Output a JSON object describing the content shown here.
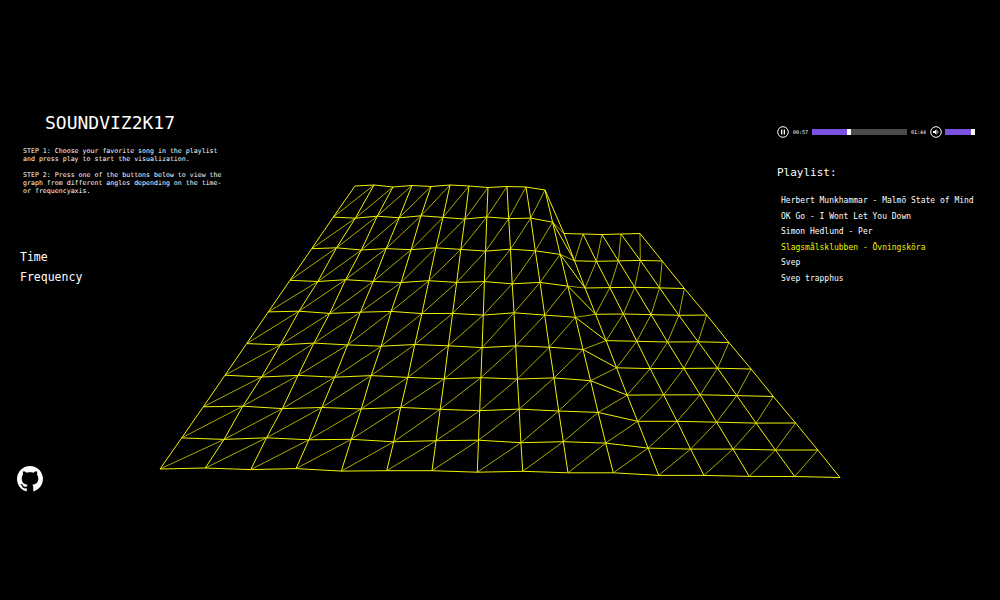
{
  "app": {
    "title": "SOUNDVIZ2K17",
    "steps": [
      "STEP 1: Choose your favorite song in the playlist and press play to start the visualization.",
      "STEP 2: Press one of the buttons below to view the graph from different angles depending on the time- or frequencyaxis."
    ]
  },
  "view_buttons": [
    {
      "label": "Time"
    },
    {
      "label": "Frequency"
    }
  ],
  "player": {
    "playing": true,
    "elapsed": "00:57",
    "duration": "01:44",
    "progress": {
      "level": 0.37
    },
    "volume": {
      "level": 0.88
    }
  },
  "playlist": {
    "heading": "Playlist:",
    "items": [
      {
        "title": "Herbert Munkhammar - Malmö State of Mind",
        "selected": false
      },
      {
        "title": "OK Go - I Wont Let You Down",
        "selected": false
      },
      {
        "title": "Simon Hedlund - Per",
        "selected": false
      },
      {
        "title": "Slagsmålsklubben - Övningsköra",
        "selected": true
      },
      {
        "title": "Svep",
        "selected": false
      },
      {
        "title": "Svep trapphus",
        "selected": false
      }
    ]
  },
  "chart": {
    "surface": [
      [
        0.02,
        0.05,
        0.03,
        0.06,
        0.02,
        0.04,
        0.05,
        0.03,
        0.06,
        0.04,
        0.05,
        0.01,
        0.02,
        0.01,
        0.02,
        0.01
      ],
      [
        0.12,
        0.1,
        0.14,
        0.11,
        0.13,
        0.09,
        0.12,
        0.14,
        0.1,
        0.13,
        0.11,
        0.02,
        0.01,
        0.02,
        0.01,
        0.02
      ],
      [
        0.22,
        0.24,
        0.2,
        0.23,
        0.21,
        0.25,
        0.22,
        0.2,
        0.24,
        0.21,
        0.19,
        0.02,
        0.03,
        0.02,
        0.01,
        0.02
      ],
      [
        0.33,
        0.3,
        0.34,
        0.31,
        0.35,
        0.32,
        0.3,
        0.33,
        0.31,
        0.34,
        0.29,
        0.01,
        0.02,
        0.03,
        0.02,
        0.01
      ],
      [
        0.44,
        0.42,
        0.46,
        0.43,
        0.41,
        0.45,
        0.43,
        0.4,
        0.44,
        0.42,
        0.38,
        0.02,
        0.01,
        0.02,
        0.03,
        0.02
      ],
      [
        0.55,
        0.57,
        0.53,
        0.56,
        0.58,
        0.54,
        0.55,
        0.52,
        0.57,
        0.53,
        0.49,
        0.03,
        0.02,
        0.01,
        0.02,
        0.01
      ],
      [
        0.66,
        0.64,
        0.68,
        0.65,
        0.63,
        0.67,
        0.64,
        0.66,
        0.62,
        0.65,
        0.58,
        0.02,
        0.03,
        0.02,
        0.01,
        0.02
      ],
      [
        0.77,
        0.79,
        0.75,
        0.78,
        0.76,
        0.8,
        0.77,
        0.74,
        0.78,
        0.75,
        0.68,
        0.01,
        0.02,
        0.03,
        0.02,
        0.01
      ],
      [
        0.88,
        0.86,
        0.9,
        0.87,
        0.91,
        0.88,
        0.85,
        0.89,
        0.86,
        0.87,
        0.79,
        0.02,
        0.01,
        0.02,
        0.03,
        0.02
      ],
      [
        0.98,
        1.0,
        0.96,
        0.99,
        0.97,
        1.0,
        0.98,
        0.95,
        0.97,
        0.96,
        0.9,
        0.03,
        0.02,
        0.01,
        0.02,
        0.03
      ]
    ]
  }
}
